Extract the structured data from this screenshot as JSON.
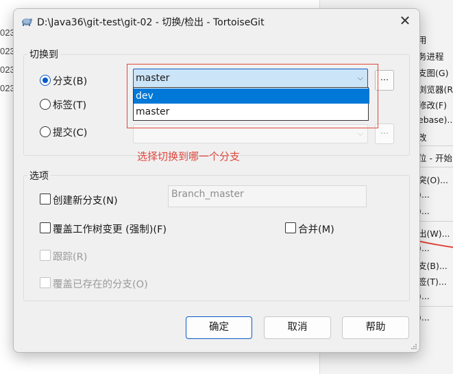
{
  "background": {
    "year_fragments": [
      "023",
      "023",
      "023",
      "023"
    ],
    "context_menu": {
      "items": [
        "用",
        "务进程",
        "支图(G)",
        "浏览器(R)",
        "修改(F)",
        "ebase)...",
        "改",
        "位 - 开始",
        "突(O)...",
        ")...",
        ")...",
        "出(W)...",
        ")...",
        "支(B)...",
        "签(T)...",
        ")...",
        ")..."
      ]
    }
  },
  "dialog": {
    "title": "D:\\Java36\\git-test\\git-02 - 切换/检出 - TortoiseGit",
    "switch_group": {
      "legend": "切换到",
      "branch_label": "分支(B)",
      "tag_label": "标签(T)",
      "commit_label": "提交(C)",
      "branch_value": "master",
      "dropdown_options": [
        "dev",
        "master"
      ],
      "browse_label": "...",
      "selected": "branch"
    },
    "annotation": "选择切换到哪一个分支",
    "options_group": {
      "legend": "选项",
      "create_branch": "创建新分支(N)",
      "new_branch_placeholder": "Branch_master",
      "force_overwrite": "覆盖工作树变更 (强制)(F)",
      "merge": "合并(M)",
      "track": "跟踪(R)",
      "override_branch": "覆盖已存在的分支(O)"
    },
    "buttons": {
      "ok": "确定",
      "cancel": "取消",
      "help": "帮助"
    },
    "colors": {
      "accent": "#0a59c6",
      "selection": "#0078d7",
      "annotation": "#e0463c"
    }
  }
}
